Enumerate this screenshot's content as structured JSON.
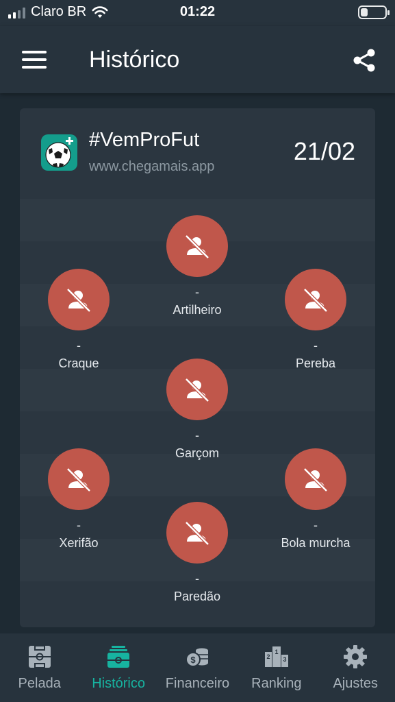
{
  "status_bar": {
    "carrier": "Claro BR",
    "time": "01:22"
  },
  "app_bar": {
    "title": "Histórico",
    "menu_icon": "hamburger-icon",
    "share_icon": "share-icon"
  },
  "card": {
    "hashtag": "#VemProFut",
    "site": "www.chegamais.app",
    "date": "21/02",
    "logo_icon": "soccer-ball-icon"
  },
  "awards": [
    {
      "id": "artilheiro",
      "player": "-",
      "label": "Artilheiro"
    },
    {
      "id": "craque",
      "player": "-",
      "label": "Craque"
    },
    {
      "id": "pereba",
      "player": "-",
      "label": "Pereba"
    },
    {
      "id": "garcom",
      "player": "-",
      "label": "Garçom"
    },
    {
      "id": "xerifao",
      "player": "-",
      "label": "Xerifão"
    },
    {
      "id": "bola-murcha",
      "player": "-",
      "label": "Bola murcha"
    },
    {
      "id": "paredao",
      "player": "-",
      "label": "Paredão"
    }
  ],
  "colors": {
    "accent": "#17b3a0",
    "award_circle": "#c0574b",
    "background": "#1e2a33",
    "card": "#2b3640"
  },
  "bottom_nav": [
    {
      "label": "Pelada",
      "icon": "field-icon",
      "active": false
    },
    {
      "label": "Histórico",
      "icon": "history-icon",
      "active": true
    },
    {
      "label": "Financeiro",
      "icon": "coins-icon",
      "active": false
    },
    {
      "label": "Ranking",
      "icon": "podium-icon",
      "active": false
    },
    {
      "label": "Ajustes",
      "icon": "gear-icon",
      "active": false
    }
  ]
}
